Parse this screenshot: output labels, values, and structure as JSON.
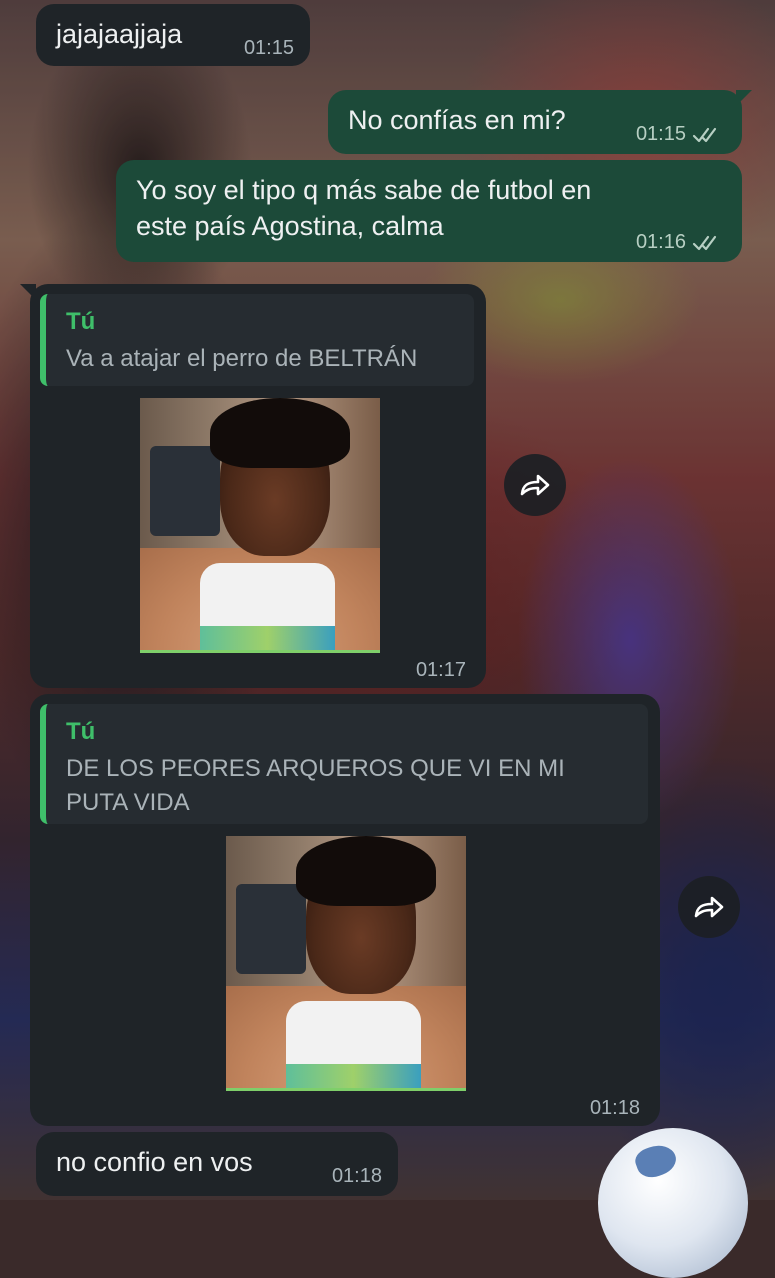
{
  "messages": [
    {
      "id": "m1",
      "text": "jajajaajjaja",
      "time": "01:15",
      "direction": "incoming"
    },
    {
      "id": "m2",
      "text": "No confías en mi?",
      "time": "01:15",
      "direction": "outgoing",
      "status": "read"
    },
    {
      "id": "m3",
      "text": "Yo soy el tipo q más sabe de futbol en\neste país Agostina, calma",
      "time": "01:16",
      "direction": "outgoing",
      "status": "read"
    },
    {
      "id": "m4",
      "quote_author": "Tú",
      "quote_text": "Va a atajar el perro de BELTRÁN",
      "time": "01:17",
      "direction": "incoming",
      "has_photo": true
    },
    {
      "id": "m5",
      "quote_author": "Tú",
      "quote_text": "DE LOS PEORES ARQUEROS QUE VI EN MI\nPUTA VIDA",
      "time": "01:18",
      "direction": "incoming",
      "has_photo": true
    },
    {
      "id": "m6",
      "text": "no confio en vos",
      "time": "01:18",
      "direction": "incoming"
    }
  ],
  "icons": {
    "forward": "forward-icon",
    "read_receipt": "double-check-icon"
  },
  "colors": {
    "incoming_bubble": "#1f2428",
    "outgoing_bubble": "#1c4a39",
    "quote_accent": "#3fbf6a"
  }
}
